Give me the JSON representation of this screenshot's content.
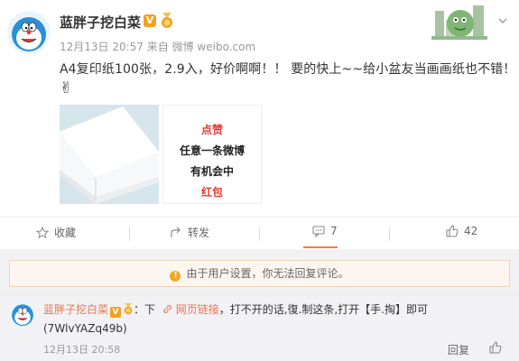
{
  "post": {
    "username": "蓝胖子挖白菜",
    "verified_badge": "V",
    "time": "12月13日 20:57",
    "source_label": "来自",
    "source": "微博 weibo.com",
    "content": "A4复印纸100张，2.9入，好价啊啊！！ 要的快上~~给小盆友当画画纸也不错！",
    "emoji": "✌",
    "promo_lines": [
      "点赞",
      "任意一条微博",
      "有机会中",
      "红包"
    ],
    "accent_color": "#eb7350"
  },
  "actions": {
    "favorite": "收藏",
    "forward": "转发",
    "comment_count": "7",
    "like_count": "42"
  },
  "comments": {
    "notice": "由于用户设置，你无法回复评论。",
    "items": [
      {
        "name": "蓝胖子挖白菜",
        "colon": "：",
        "text_before": "下",
        "link_label": "网页链接",
        "text_after": "，打不开的话,復.制这条,打开【手.掏】即可",
        "line2": "(7WlvYAZq49b)",
        "time": "12月13日 20:58",
        "reply": "回复"
      }
    ]
  }
}
